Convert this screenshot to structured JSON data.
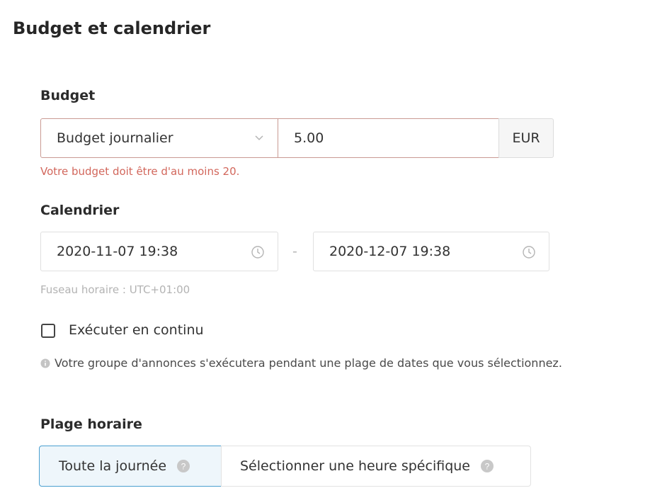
{
  "page": {
    "title": "Budget et calendrier"
  },
  "budget": {
    "label": "Budget",
    "type_select": "Budget journalier",
    "amount": "5.00",
    "currency": "EUR",
    "error": "Votre budget doit être d'au moins 20."
  },
  "schedule": {
    "label": "Calendrier",
    "start": "2020-11-07 19:38",
    "separator": "-",
    "end": "2020-12-07 19:38",
    "timezone": "Fuseau horaire : UTC+01:00",
    "continuous_label": "Exécuter en continu",
    "continuous_checked": false,
    "info": "Votre groupe d'annonces s'exécutera pendant une plage de dates que vous sélectionnez."
  },
  "time_range": {
    "label": "Plage horaire",
    "options": [
      {
        "label": "Toute la journée",
        "selected": true
      },
      {
        "label": "Sélectionner une heure spécifique",
        "selected": false
      }
    ]
  },
  "colors": {
    "error": "#d2675c",
    "selected_border": "#4a9fd0",
    "selected_bg": "#eef6fb"
  },
  "icons": [
    "chevron-down-icon",
    "clock-icon",
    "info-icon",
    "help-icon"
  ]
}
